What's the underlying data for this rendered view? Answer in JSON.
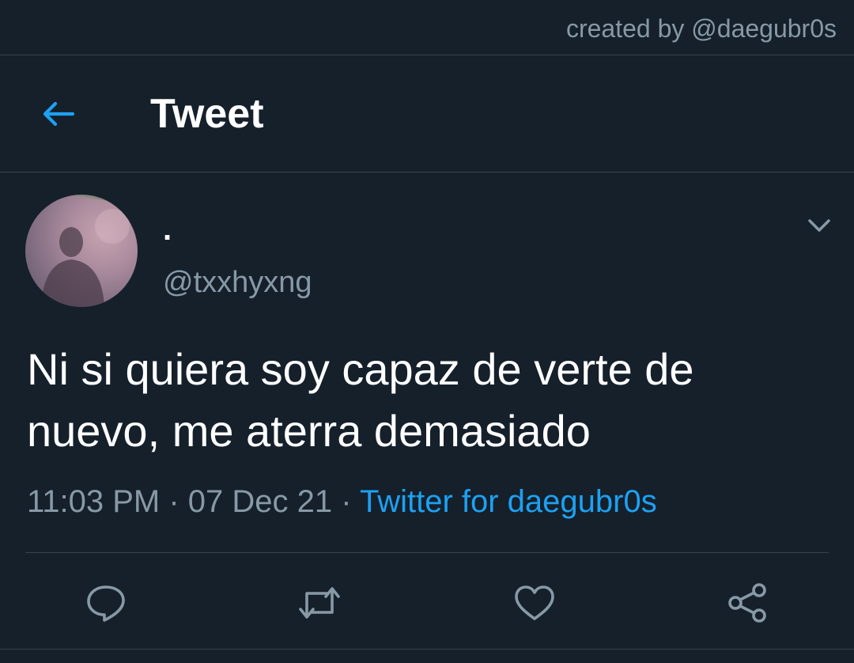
{
  "credit": {
    "text": "created by @daegubr0s"
  },
  "header": {
    "title": "Tweet",
    "back_icon": "arrow-left-icon"
  },
  "tweet": {
    "display_name": ".",
    "handle": "@txxhyxng",
    "text": "Ni si quiera soy capaz de verte de nuevo, me aterra demasiado",
    "time": "11:03 PM",
    "separator": " · ",
    "date": "07 Dec 21",
    "source": "Twitter for daegubr0s"
  },
  "actions": [
    "reply-icon",
    "retweet-icon",
    "like-icon",
    "share-icon"
  ],
  "colors": {
    "background": "#15202b",
    "accent": "#1da1f2",
    "secondary_text": "#8899a6",
    "divider": "#38444d"
  }
}
